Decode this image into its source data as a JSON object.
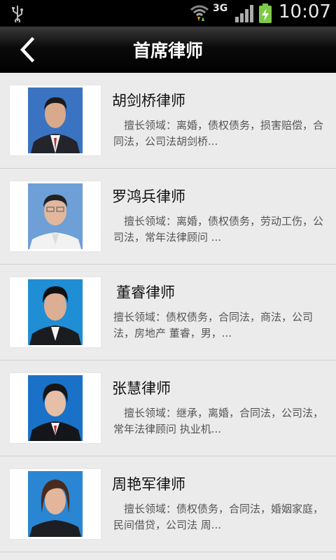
{
  "status_bar": {
    "network_type": "3G",
    "time": "10:07",
    "icons": [
      "usb-icon",
      "wifi-icon",
      "signal-icon",
      "battery-charging-icon"
    ]
  },
  "header": {
    "title": "首席律师",
    "back_icon": "chevron-left-icon"
  },
  "lawyers": [
    {
      "name": "胡剑桥律师",
      "description": "擅长领域：离婚，债权债务，损害赔偿，合同法，公司法胡剑桥..."
    },
    {
      "name": "罗鸿兵律师",
      "description": "擅长领域：离婚，债权债务，劳动工伤，公司法，常年法律顾问 ..."
    },
    {
      "name": "董睿律师",
      "description": "擅长领域：债权债务，合同法，商法，公司法，房地产  董睿，男，..."
    },
    {
      "name": "张慧律师",
      "description": "擅长领域：继承，离婚，合同法，公司法，常年法律顾问 执业机..."
    },
    {
      "name": "周艳军律师",
      "description": "擅长领域：债权债务，合同法，婚姻家庭，民间借贷，公司法 周..."
    }
  ]
}
